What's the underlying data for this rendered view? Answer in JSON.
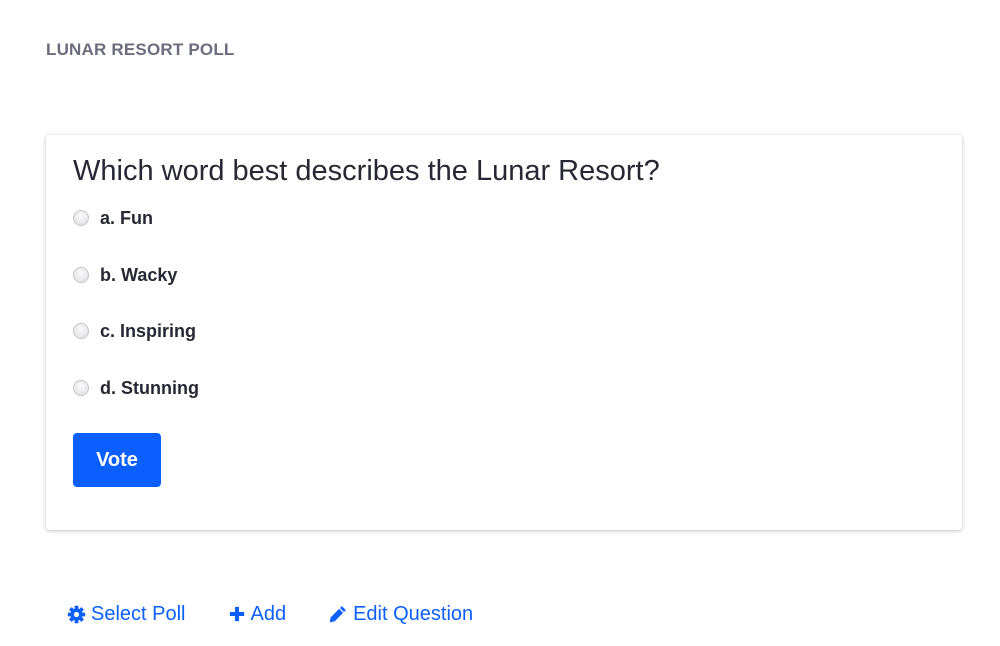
{
  "portlet": {
    "title": "LUNAR RESORT POLL"
  },
  "poll": {
    "question": "Which word best describes the Lunar Resort?",
    "choices": [
      {
        "label": "a. Fun",
        "selected": false
      },
      {
        "label": "b. Wacky",
        "selected": false
      },
      {
        "label": "c. Inspiring",
        "selected": false
      },
      {
        "label": "d. Stunning",
        "selected": false
      }
    ],
    "vote_label": "Vote"
  },
  "actions": {
    "select_poll": {
      "label": "Select Poll",
      "icon": "cog-icon"
    },
    "add": {
      "label": "Add",
      "icon": "plus-icon"
    },
    "edit_question": {
      "label": "Edit Question",
      "icon": "pencil-icon"
    }
  },
  "colors": {
    "accent": "#0b5fff",
    "title_gray": "#6b6c7e",
    "text_dark": "#272833"
  }
}
